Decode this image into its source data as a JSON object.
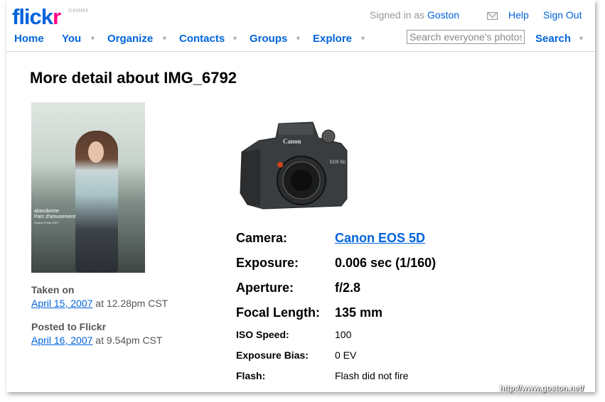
{
  "header": {
    "logo_flick": "flick",
    "logo_r": "r",
    "logo_badge": "GAMMA",
    "signed_in_prefix": "Signed in as",
    "username": "Goston",
    "help": "Help",
    "sign_out": "Sign Out"
  },
  "nav": {
    "home": "Home",
    "you": "You",
    "organize": "Organize",
    "contacts": "Contacts",
    "groups": "Groups",
    "explore": "Explore",
    "search_placeholder": "Search everyone's photos",
    "search": "Search"
  },
  "page": {
    "title": "More detail about IMG_6792"
  },
  "photo": {
    "caption_line1": "abandonne",
    "caption_line2": "Parc d'amusement",
    "caption_line3": "Goston Photo 2007",
    "taken_label": "Taken on",
    "taken_date": "April 15, 2007",
    "taken_time": "at 12.28pm CST",
    "posted_label": "Posted to Flickr",
    "posted_date": "April 16, 2007",
    "posted_time": "at 9.54pm CST"
  },
  "exif": {
    "camera_label": "Camera:",
    "camera_value": "Canon EOS 5D",
    "exposure_label": "Exposure:",
    "exposure_value": "0.006 sec (1/160)",
    "aperture_label": "Aperture:",
    "aperture_value": "f/2.8",
    "focal_label": "Focal Length:",
    "focal_value": "135 mm",
    "iso_label": "ISO Speed:",
    "iso_value": "100",
    "bias_label": "Exposure Bias:",
    "bias_value": "0 EV",
    "flash_label": "Flash:",
    "flash_value": "Flash did not fire"
  },
  "camera_image": {
    "brand_text": "Canon",
    "model_text": "EOS 5D"
  },
  "watermark": "http://www.goston.net/",
  "colors": {
    "link": "#0063dc",
    "brand_pink": "#ff0084"
  }
}
